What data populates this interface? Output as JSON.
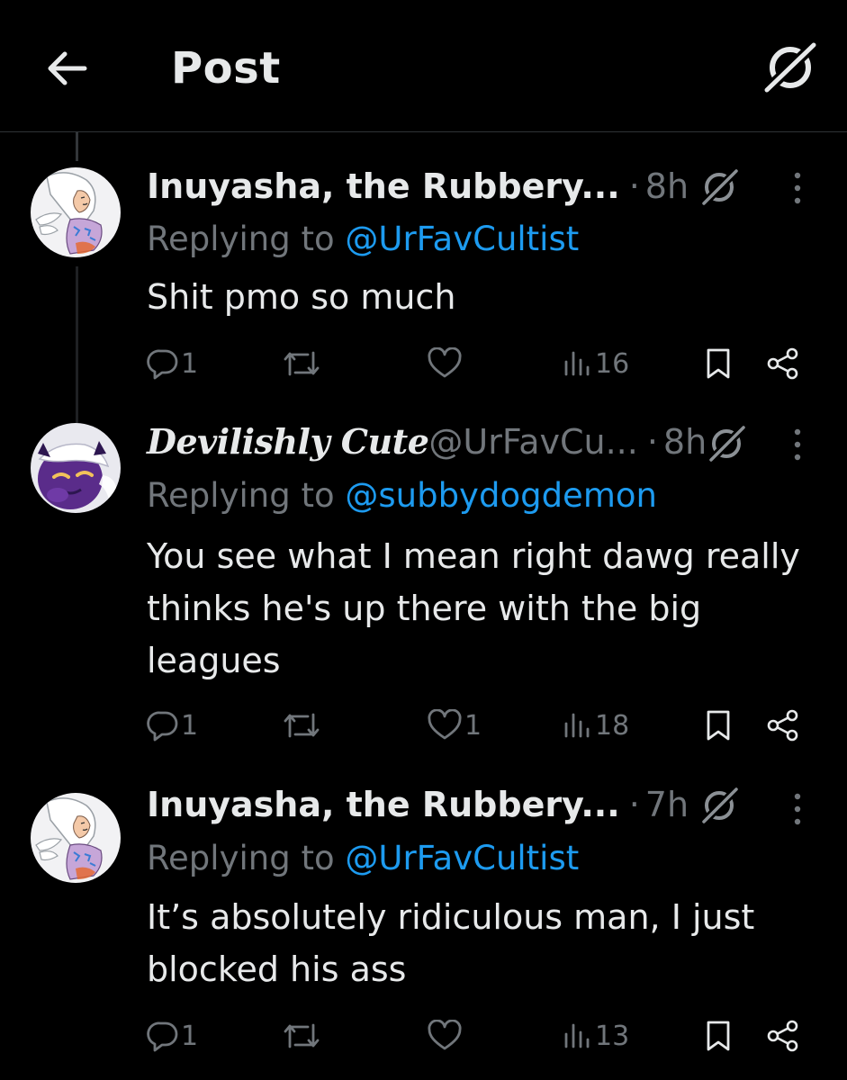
{
  "header": {
    "title": "Post"
  },
  "tweets": [
    {
      "name": "Inuyasha, the Rubbery...",
      "handle": "",
      "dot": "·",
      "time": "8h",
      "replying_prefix": "Replying to ",
      "replying_to": "@UrFavCultist",
      "text": "Shit pmo so much",
      "replies": "1",
      "reposts": "",
      "likes": "",
      "views": "16"
    },
    {
      "name": "Devilishly Cute",
      "handle": "@UrFavCu...",
      "dot": "·",
      "time": "8h",
      "replying_prefix": "Replying to ",
      "replying_to": "@subbydogdemon",
      "text": "You see what I mean right dawg really thinks he's up there with the big leagues",
      "replies": "1",
      "reposts": "",
      "likes": "1",
      "views": "18"
    },
    {
      "name": "Inuyasha, the Rubbery...",
      "handle": "",
      "dot": "·",
      "time": "7h",
      "replying_prefix": "Replying to ",
      "replying_to": "@UrFavCultist",
      "text": "It’s absolutely ridiculous man, I just blocked his ass",
      "replies": "1",
      "reposts": "",
      "likes": "",
      "views": "13"
    }
  ],
  "icons": {
    "back": "arrow-left-icon",
    "grok": "grok-icon",
    "more": "more-vertical-icon",
    "reply": "reply-icon",
    "repost": "repost-icon",
    "like": "heart-icon",
    "views": "views-icon",
    "bookmark": "bookmark-icon",
    "share": "share-icon"
  },
  "colors": {
    "background": "#000000",
    "text": "#e7e9ea",
    "muted": "#71767b",
    "link": "#1d9bf0",
    "divider": "#2f3336"
  }
}
